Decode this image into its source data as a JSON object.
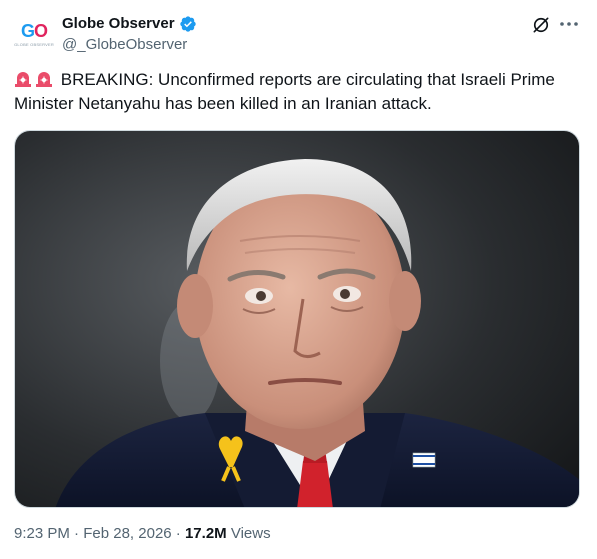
{
  "author": {
    "avatar_text_a": "G",
    "avatar_text_b": "O",
    "avatar_tagline": "GLOBE OBSERVER",
    "display_name": "Globe Observer",
    "handle": "@_GlobeObserver",
    "verified_color": "#1d9bf0"
  },
  "tweet": {
    "text_line": "BREAKING: Unconfirmed reports are circulating that Israeli Prime Minister Netanyahu has been killed in an Iranian attack.",
    "leading_icons": [
      "siren-icon",
      "siren-icon"
    ]
  },
  "footer": {
    "time": "9:23 PM",
    "separator": "·",
    "date": "Feb 28, 2026",
    "views_count": "17.2M",
    "views_label": "Views"
  },
  "colors": {
    "text": "#0f1419",
    "muted": "#536471",
    "border": "#cfd9de"
  }
}
